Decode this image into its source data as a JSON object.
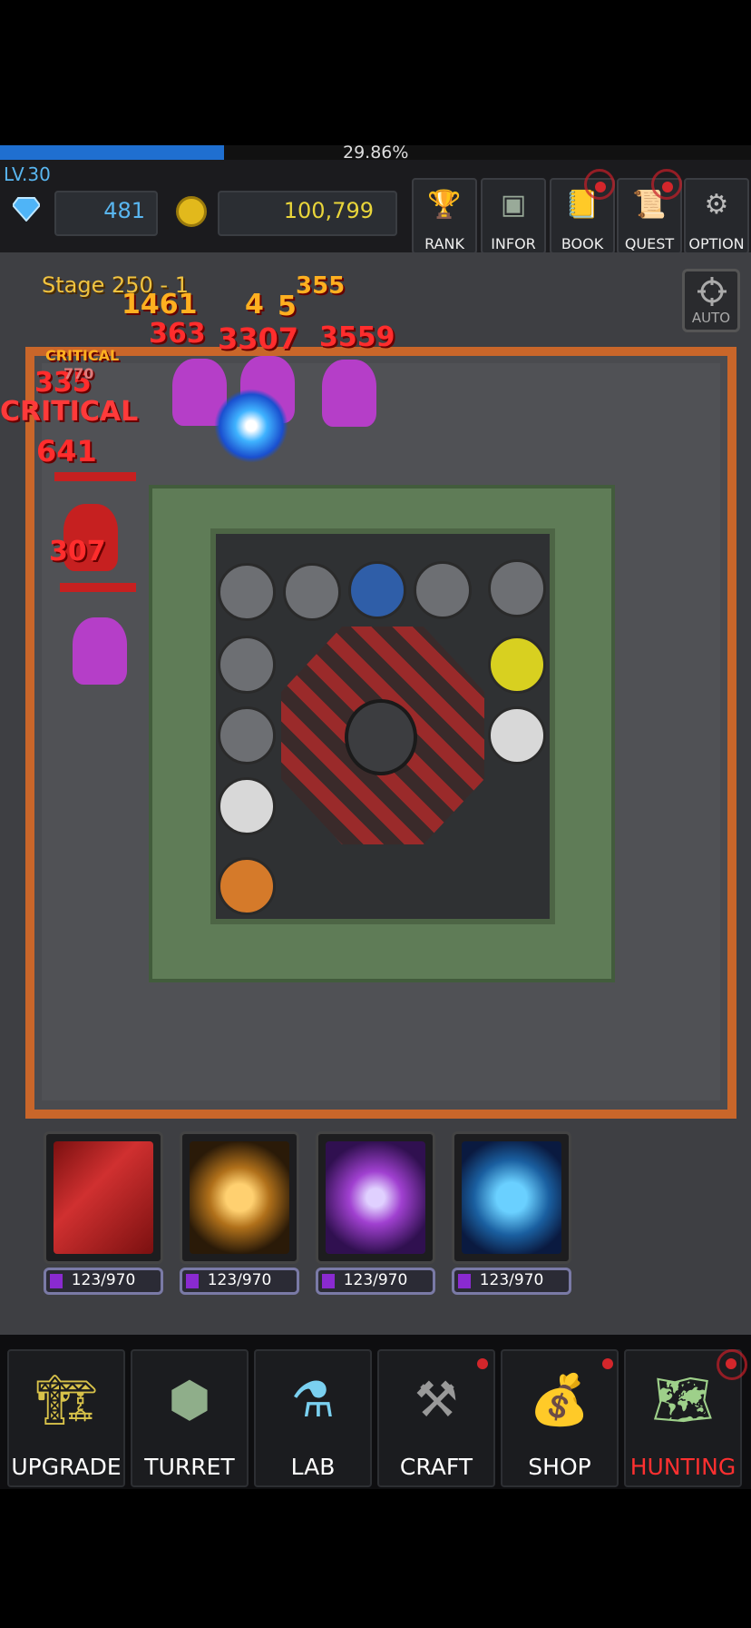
{
  "progress": {
    "percent_text": "29.86%",
    "fraction": 0.2986
  },
  "player": {
    "level": "LV.30",
    "gems": "481",
    "gold": "100,799"
  },
  "header_buttons": [
    {
      "label": "RANK",
      "icon": "trophy-icon"
    },
    {
      "label": "INFOR",
      "icon": "terminal-icon"
    },
    {
      "label": "BOOK",
      "icon": "book-icon"
    },
    {
      "label": "QUEST",
      "icon": "scroll-icon"
    },
    {
      "label": "OPTION",
      "icon": "gear-icon"
    }
  ],
  "stage": {
    "text": "Stage 250 - 1"
  },
  "auto_button": {
    "label": "AUTO"
  },
  "damage_numbers": [
    "1461",
    "4",
    "5",
    "363",
    "3307",
    "3559",
    "CRITICAL",
    "335",
    "CRITICAL",
    "641",
    "307",
    "770",
    "355"
  ],
  "skills": [
    {
      "name": "bullets-skill",
      "charge": "123/970"
    },
    {
      "name": "target-skill",
      "charge": "123/970"
    },
    {
      "name": "speed-skill",
      "charge": "123/970"
    },
    {
      "name": "tornado-skill",
      "charge": "123/970"
    }
  ],
  "nav": [
    {
      "label": "UPGRADE",
      "icon": "crane-icon"
    },
    {
      "label": "TURRET",
      "icon": "turret-icon"
    },
    {
      "label": "LAB",
      "icon": "lab-icon"
    },
    {
      "label": "CRAFT",
      "icon": "anvil-icon"
    },
    {
      "label": "SHOP",
      "icon": "money-bag-icon"
    },
    {
      "label": "HUNTING",
      "icon": "map-icon"
    }
  ],
  "colors": {
    "accent_blue": "#59b6f0",
    "gold": "#e9d53a",
    "active_nav": "#ff3030",
    "lava": "#c9662a"
  }
}
